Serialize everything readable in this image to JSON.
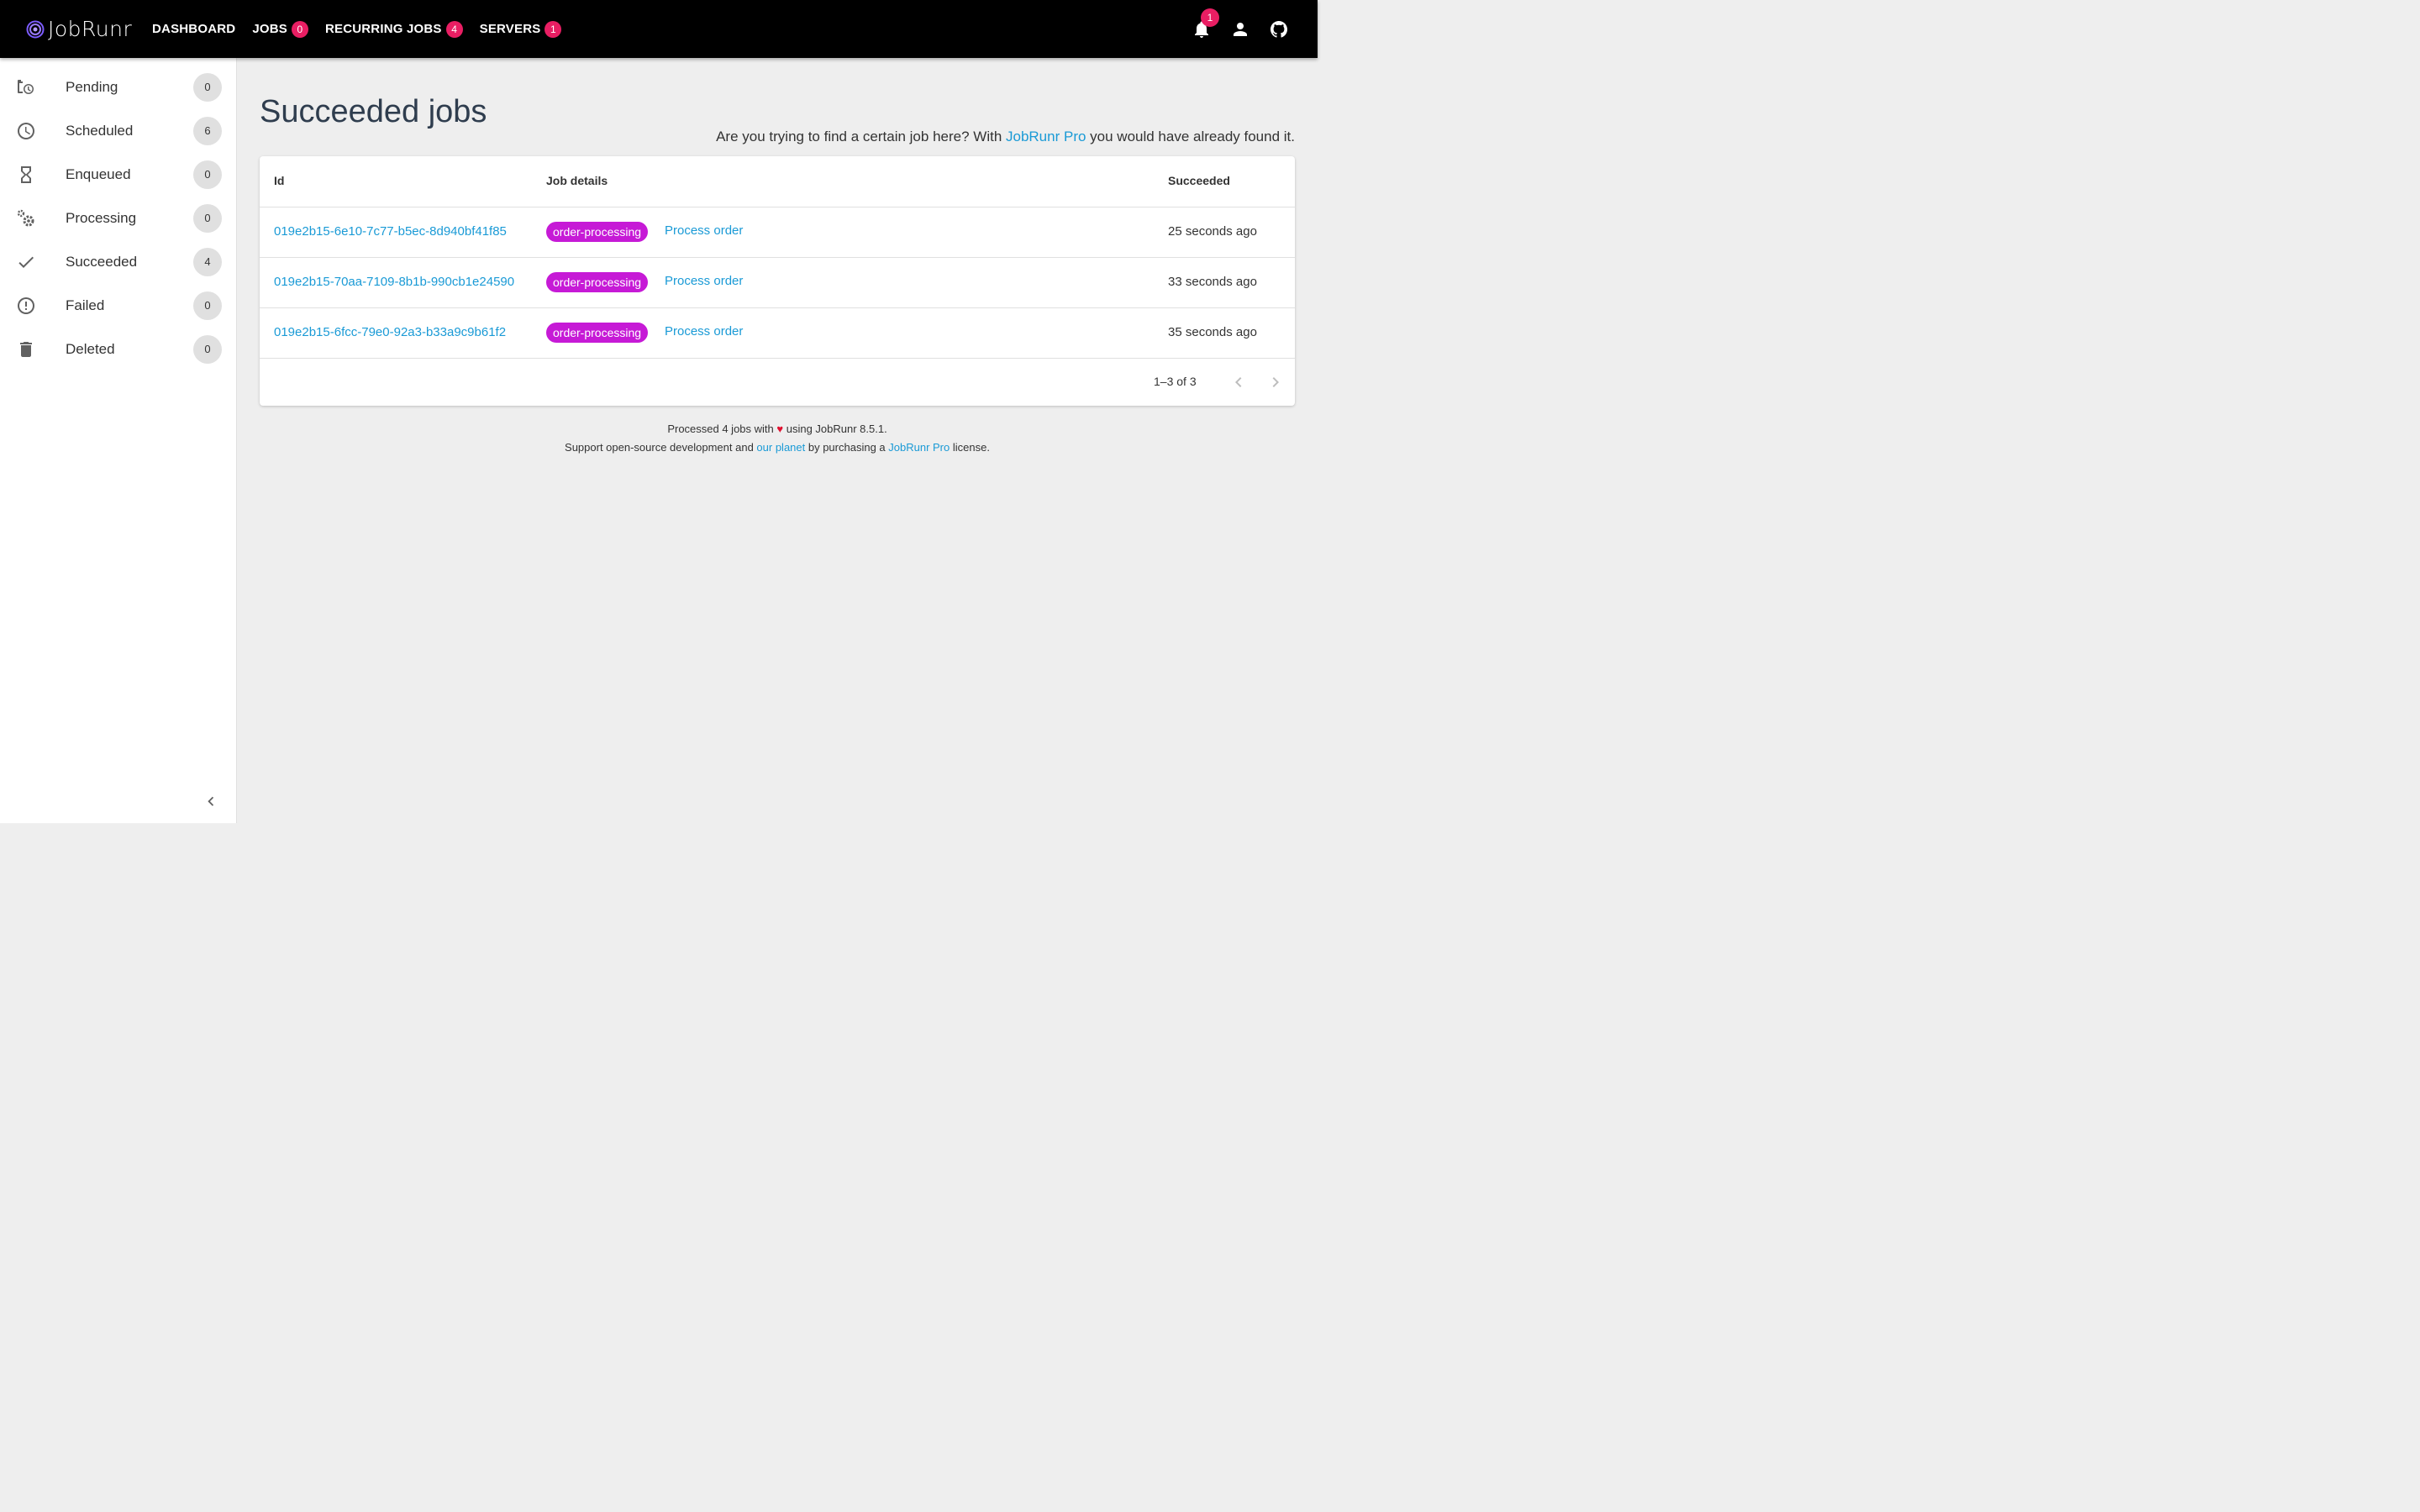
{
  "app": {
    "logo_text": "JobRunr"
  },
  "nav": [
    {
      "label": "DASHBOARD",
      "badge": ""
    },
    {
      "label": "JOBS",
      "badge": "0"
    },
    {
      "label": "RECURRING JOBS",
      "badge": "4"
    },
    {
      "label": "SERVERS",
      "badge": "1"
    }
  ],
  "topbar": {
    "notifications_count": "1"
  },
  "sidebar": {
    "items": [
      {
        "label": "Pending",
        "count": "0",
        "icon": "pending-clock-icon"
      },
      {
        "label": "Scheduled",
        "count": "6",
        "icon": "clock-icon"
      },
      {
        "label": "Enqueued",
        "count": "0",
        "icon": "hourglass-icon"
      },
      {
        "label": "Processing",
        "count": "0",
        "icon": "gears-icon"
      },
      {
        "label": "Succeeded",
        "count": "4",
        "icon": "check-icon"
      },
      {
        "label": "Failed",
        "count": "0",
        "icon": "alert-circle-icon"
      },
      {
        "label": "Deleted",
        "count": "0",
        "icon": "trash-icon"
      }
    ]
  },
  "main": {
    "title": "Succeeded jobs",
    "hint_prefix": "Are you trying to find a certain job here? With ",
    "hint_link": "JobRunr Pro",
    "hint_suffix": " you would have already found it.",
    "columns": {
      "id": "Id",
      "details": "Job details",
      "time": "Succeeded"
    },
    "rows": [
      {
        "id": "019e2b15-6e10-7c77-b5ec-8d940bf41f85",
        "tag": "order-processing",
        "name": "Process order",
        "time": "25 seconds ago"
      },
      {
        "id": "019e2b15-70aa-7109-8b1b-990cb1e24590",
        "tag": "order-processing",
        "name": "Process order",
        "time": "33 seconds ago"
      },
      {
        "id": "019e2b15-6fcc-79e0-92a3-b33a9c9b61f2",
        "tag": "order-processing",
        "name": "Process order",
        "time": "35 seconds ago"
      }
    ],
    "pagination": "1–3 of 3"
  },
  "footer": {
    "line1_prefix": "Processed 4 jobs with ",
    "heart": "♥",
    "line1_suffix": " using JobRunr 8.5.1.",
    "line2_a": "Support open-source development and ",
    "line2_link1": "our planet",
    "line2_b": " by purchasing a ",
    "line2_link2": "JobRunr Pro",
    "line2_c": " license."
  },
  "colors": {
    "accent": "#1a9ad6",
    "badge": "#e91e63",
    "tag": "#c61ad6",
    "topbar": "#000000"
  }
}
